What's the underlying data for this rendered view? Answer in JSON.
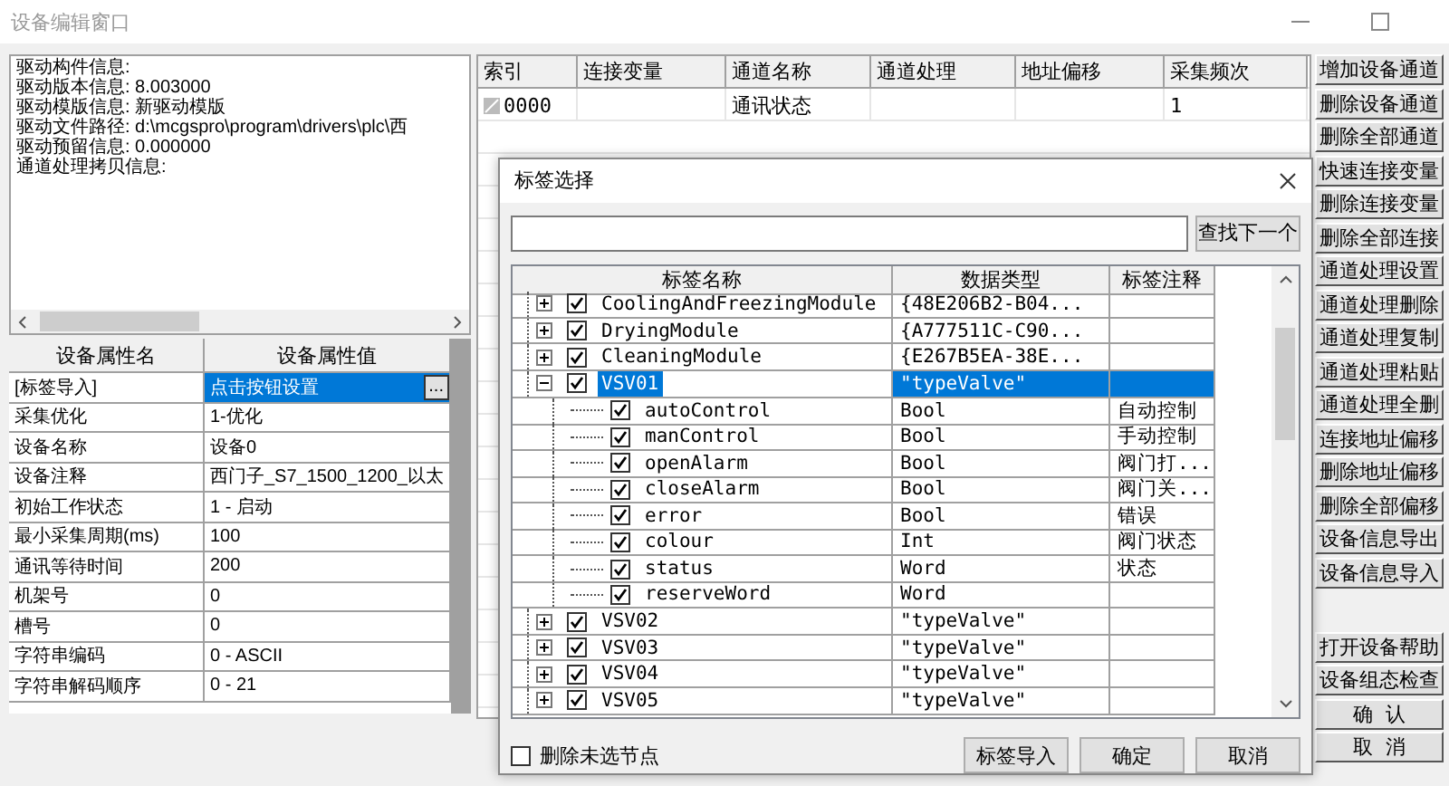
{
  "window": {
    "title": "设备编辑窗口"
  },
  "driver_info": {
    "lines": [
      "驱动构件信息:",
      "驱动版本信息: 8.003000",
      "驱动模版信息: 新驱动模版",
      "驱动文件路径: d:\\mcgspro\\program\\drivers\\plc\\西",
      "驱动预留信息: 0.000000",
      "通道处理拷贝信息:"
    ]
  },
  "property_grid": {
    "columns": [
      "设备属性名",
      "设备属性值"
    ],
    "rows": [
      {
        "name": "[标签导入]",
        "value": "点击按钮设置",
        "selected": true,
        "button": "..."
      },
      {
        "name": "采集优化",
        "value": "1-优化",
        "selected": false
      },
      {
        "name": "设备名称",
        "value": "设备0",
        "selected": false
      },
      {
        "name": "设备注释",
        "value": "西门子_S7_1500_1200_以太",
        "selected": false
      },
      {
        "name": "初始工作状态",
        "value": "1 - 启动",
        "selected": false
      },
      {
        "name": "最小采集周期(ms)",
        "value": "100",
        "selected": false
      },
      {
        "name": "通讯等待时间",
        "value": "200",
        "selected": false
      },
      {
        "name": "机架号",
        "value": "0",
        "selected": false
      },
      {
        "name": "槽号",
        "value": "0",
        "selected": false
      },
      {
        "name": "字符串编码",
        "value": "0 - ASCII",
        "selected": false
      },
      {
        "name": "字符串解码顺序",
        "value": "0 - 21",
        "selected": false
      }
    ]
  },
  "channel_table": {
    "columns": [
      "索引",
      "连接变量",
      "通道名称",
      "通道处理",
      "地址偏移",
      "采集频次"
    ],
    "rows": [
      {
        "index": "0000",
        "channel_name": "通讯状态",
        "collection_frequency": "1"
      }
    ]
  },
  "channel_buttons": [
    "增加设备通道",
    "删除设备通道",
    "删除全部通道",
    "快速连接变量",
    "删除连接变量",
    "删除全部连接",
    "通道处理设置",
    "通道处理删除",
    "通道处理复制",
    "通道处理粘贴",
    "通道处理全删",
    "连接地址偏移",
    "删除地址偏移",
    "删除全部偏移",
    "设备信息导出",
    "设备信息导入"
  ],
  "window_buttons": [
    "打开设备帮助",
    "设备组态检查",
    "确  认",
    "取  消"
  ],
  "tag_dialog": {
    "title": "标签选择",
    "search_button": "查找下一个",
    "columns": [
      "标签名称",
      "数据类型",
      "标签注释"
    ],
    "tags": [
      {
        "name": "CoolingAndFreezingModule",
        "data_type": "{48E206B2-B04...",
        "checked": true,
        "selected": false,
        "expanded": false
      },
      {
        "name": "DryingModule",
        "data_type": "{A777511C-C90...",
        "checked": true,
        "selected": false,
        "expanded": false
      },
      {
        "name": "CleaningModule",
        "data_type": "{E267B5EA-38E...",
        "checked": true,
        "selected": false,
        "expanded": false
      },
      {
        "name": "VSV01",
        "data_type": "\"typeValve\"",
        "checked": true,
        "selected": true,
        "expanded": true,
        "children": [
          {
            "name": "autoControl",
            "data_type": "Bool",
            "comment": "自动控制",
            "checked": true,
            "selected": false
          },
          {
            "name": "manControl",
            "data_type": "Bool",
            "comment": "手动控制",
            "checked": true,
            "selected": false
          },
          {
            "name": "openAlarm",
            "data_type": "Bool",
            "comment": "阀门打...",
            "checked": true,
            "selected": false
          },
          {
            "name": "closeAlarm",
            "data_type": "Bool",
            "comment": "阀门关...",
            "checked": true,
            "selected": false
          },
          {
            "name": "error",
            "data_type": "Bool",
            "comment": "错误",
            "checked": true,
            "selected": false
          },
          {
            "name": "colour",
            "data_type": "Int",
            "comment": "阀门状态",
            "checked": true,
            "selected": false
          },
          {
            "name": "status",
            "data_type": "Word",
            "comment": "状态",
            "checked": true,
            "selected": false
          },
          {
            "name": "reserveWord",
            "data_type": "Word",
            "checked": true,
            "selected": false
          }
        ]
      },
      {
        "name": "VSV02",
        "data_type": "\"typeValve\"",
        "checked": true,
        "selected": false,
        "expanded": false
      },
      {
        "name": "VSV03",
        "data_type": "\"typeValve\"",
        "checked": true,
        "selected": false,
        "expanded": false
      },
      {
        "name": "VSV04",
        "data_type": "\"typeValve\"",
        "checked": true,
        "selected": false,
        "expanded": false
      },
      {
        "name": "VSV05",
        "data_type": "\"typeValve\"",
        "checked": true,
        "selected": false,
        "expanded": false
      }
    ],
    "delete_unselected": {
      "label": "删除未选节点",
      "checked": false
    },
    "buttons": [
      "标签导入",
      "确定",
      "取消"
    ]
  }
}
